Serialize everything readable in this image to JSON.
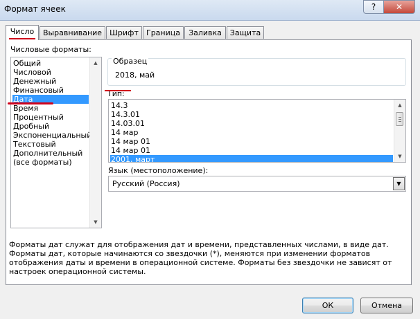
{
  "window": {
    "title": "Формат ячеек",
    "help_label": "?",
    "close_label": "✕"
  },
  "tabs": [
    {
      "label": "Число",
      "active": true
    },
    {
      "label": "Выравнивание"
    },
    {
      "label": "Шрифт"
    },
    {
      "label": "Граница"
    },
    {
      "label": "Заливка"
    },
    {
      "label": "Защита"
    }
  ],
  "formats": {
    "label": "Числовые форматы:",
    "items": [
      "Общий",
      "Числовой",
      "Денежный",
      "Финансовый",
      "Дата",
      "Время",
      "Процентный",
      "Дробный",
      "Экспоненциальный",
      "Текстовый",
      "Дополнительный",
      "(все форматы)"
    ],
    "selected_index": 4
  },
  "sample": {
    "label": "Образец",
    "value": "2018, май"
  },
  "type": {
    "label": "Тип:",
    "items": [
      "14.3",
      "14.3.01",
      "14.03.01",
      "14 мар",
      "14 мар 01",
      "14 мар 01",
      "2001, март"
    ],
    "selected_index": 6
  },
  "locale": {
    "label": "Язык (местоположение):",
    "value": "Русский (Россия)"
  },
  "description": "Форматы дат служат для отображения дат и времени, представленных числами, в виде дат. Форматы дат, которые начинаются со звездочки (*), меняются при изменении форматов отображения даты и времени в операционной системе. Форматы без звездочки не зависят от настроек операционной системы.",
  "buttons": {
    "ok": "ОК",
    "cancel": "Отмена"
  },
  "colors": {
    "selection": "#3399ff",
    "annotation": "#d0021b"
  }
}
